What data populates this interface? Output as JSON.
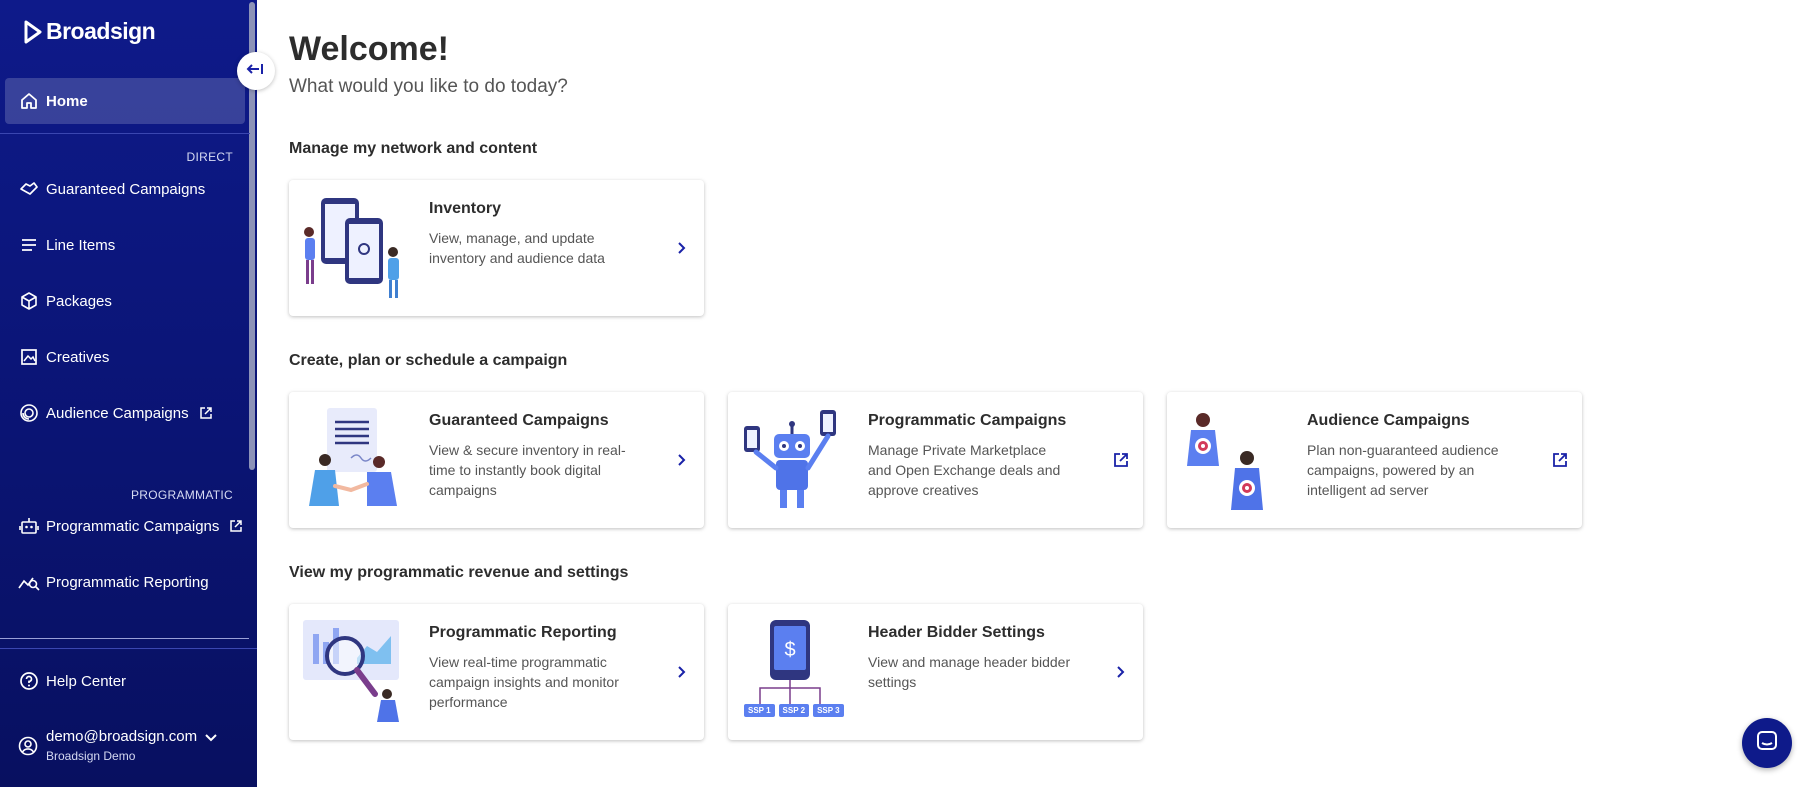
{
  "sidebar": {
    "brand": "Broadsign",
    "home": "Home",
    "direct_label": "DIRECT",
    "direct_items": [
      {
        "label": "Guaranteed Campaigns"
      },
      {
        "label": "Line Items"
      },
      {
        "label": "Packages"
      },
      {
        "label": "Creatives"
      },
      {
        "label": "Audience Campaigns"
      }
    ],
    "programmatic_label": "PROGRAMMATIC",
    "programmatic_items": [
      {
        "label": "Programmatic Campaigns"
      },
      {
        "label": "Programmatic Reporting"
      }
    ],
    "help": "Help Center",
    "user_email": "demo@broadsign.com",
    "user_org": "Broadsign Demo"
  },
  "main": {
    "title": "Welcome!",
    "subtitle": "What would you like to do today?",
    "sections": [
      {
        "heading": "Manage my network and content"
      },
      {
        "heading": "Create, plan or schedule a campaign"
      },
      {
        "heading": "View my programmatic revenue and settings"
      }
    ],
    "cards": {
      "inventory": {
        "title": "Inventory",
        "desc": "View, manage, and update inventory and audience data"
      },
      "guaranteed": {
        "title": "Guaranteed Campaigns",
        "desc": "View & secure inventory in real-time to instantly book digital campaigns"
      },
      "programmatic": {
        "title": "Programmatic Campaigns",
        "desc": "Manage Private Marketplace and Open Exchange deals and approve creatives"
      },
      "audience": {
        "title": "Audience Campaigns",
        "desc": "Plan non-guaranteed audience campaigns, powered by an intelligent ad server"
      },
      "reporting": {
        "title": "Programmatic Reporting",
        "desc": "View real-time programmatic campaign insights and monitor performance"
      },
      "header_bidder": {
        "title": "Header Bidder Settings",
        "desc": "View and manage header bidder settings"
      }
    },
    "ssp_labels": [
      "SSP 1",
      "SSP 2",
      "SSP 3"
    ]
  },
  "colors": {
    "sidebar": "#0e1a8a",
    "accent": "#1a22a8",
    "illustration": "#5b7ff0"
  }
}
